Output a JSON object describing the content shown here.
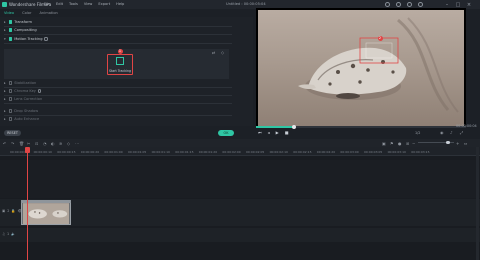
{
  "app": {
    "name": "Wondershare Filmora",
    "document_title": "Untitled : 00:00:05:04",
    "menu": [
      "File",
      "Edit",
      "Tools",
      "View",
      "Export",
      "Help"
    ],
    "window_controls": [
      "minimize",
      "maximize",
      "close"
    ]
  },
  "editor_tabs": [
    {
      "label": "Video",
      "active": true
    },
    {
      "label": "Color",
      "active": false
    },
    {
      "label": "Animation",
      "active": false
    }
  ],
  "sections": [
    {
      "label": "Transform",
      "checked": true,
      "dim": false
    },
    {
      "label": "Compositing",
      "checked": true,
      "dim": false
    },
    {
      "label": "Motion Tracking",
      "checked": true,
      "dim": false
    },
    {
      "label": "Stabilization",
      "checked": false,
      "dim": true
    },
    {
      "label": "Chroma Key",
      "checked": false,
      "dim": true
    },
    {
      "label": "Lens Correction",
      "checked": false,
      "dim": true
    },
    {
      "label": "Drop Shadow",
      "checked": false,
      "dim": true
    },
    {
      "label": "Auto Enhance",
      "checked": false,
      "dim": true
    }
  ],
  "motion_tracking": {
    "badge": "1",
    "start_label": "Start Tracking"
  },
  "buttons": {
    "reset": "RESET",
    "ok": "OK"
  },
  "preview": {
    "timecode": "00:00:00:04",
    "quality": "1/2",
    "tracker_badge": "2",
    "progress": 0.18
  },
  "timeline": {
    "ticks": [
      "00:00:00:00",
      "00:00:00:10",
      "00:00:00:15",
      "00:00:00:20",
      "00:00:01:00",
      "00:00:01:05",
      "00:00:01:10",
      "00:00:01:15",
      "00:00:01:20",
      "00:00:02:00",
      "00:00:02:05",
      "00:00:02:10",
      "00:00:02:15",
      "00:00:02:20",
      "00:00:03:00",
      "00:00:03:05",
      "00:00:03:10",
      "00:00:03:15"
    ],
    "tracks": [
      {
        "num": "2"
      },
      {
        "num": "1"
      }
    ]
  },
  "colors": {
    "accent": "#2fc6a4",
    "highlight": "#e04545",
    "background": "#1c2026"
  }
}
